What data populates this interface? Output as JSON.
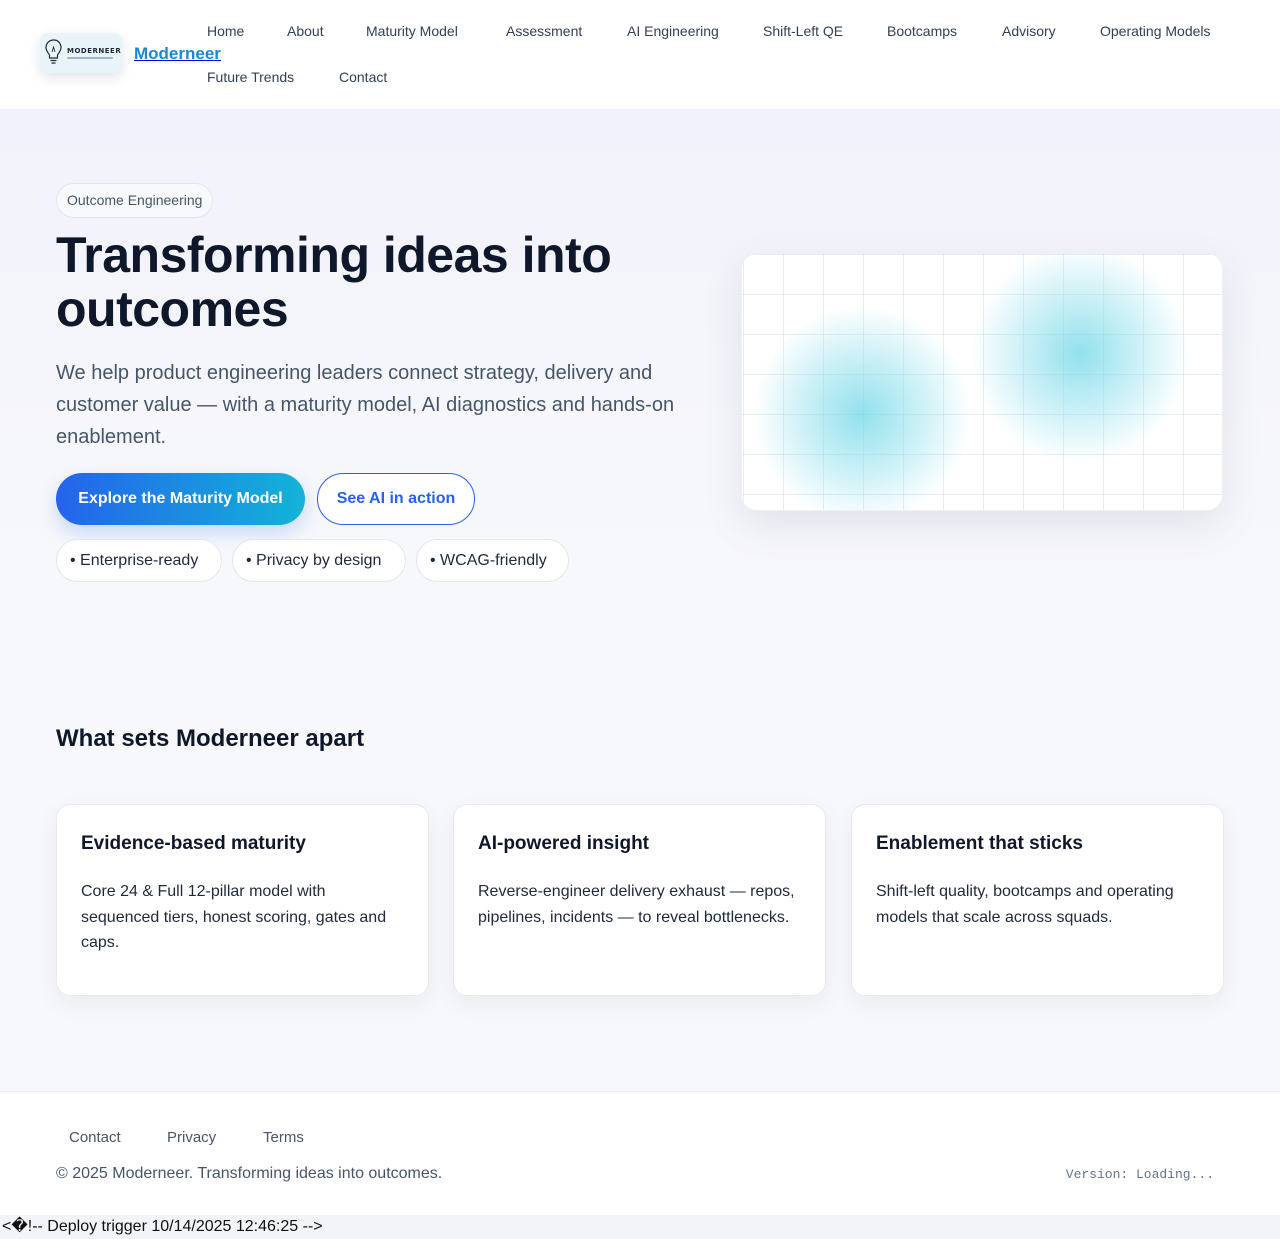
{
  "brand": {
    "logo_text": "MODERNEER",
    "name": "Moderneer"
  },
  "nav": [
    {
      "label": "Home"
    },
    {
      "label": "About"
    },
    {
      "label": "Maturity Model"
    },
    {
      "label": "Assessment"
    },
    {
      "label": "AI Engineering"
    },
    {
      "label": "Shift-Left QE"
    },
    {
      "label": "Bootcamps"
    },
    {
      "label": "Advisory"
    },
    {
      "label": "Operating Models"
    },
    {
      "label": "Future Trends"
    },
    {
      "label": "Contact"
    }
  ],
  "hero": {
    "eyebrow": "Outcome Engineering",
    "title": "Transforming ideas into outcomes",
    "subtitle": "We help product engineering leaders connect strategy, delivery and customer value — with a maturity model, AI diagnostics and hands-on enablement.",
    "primary_cta": "Explore the Maturity Model",
    "secondary_cta": "See AI in action",
    "chips": [
      "• Enterprise-ready",
      "• Privacy by design",
      "• WCAG-friendly"
    ]
  },
  "features": {
    "title": "What sets Moderneer apart",
    "cards": [
      {
        "title": "Evidence-based maturity",
        "text": "Core 24 & Full 12-pillar model with sequenced tiers, honest scoring, gates and caps."
      },
      {
        "title": "AI-powered insight",
        "text": "Reverse-engineer delivery exhaust — repos, pipelines, incidents — to reveal bottlenecks."
      },
      {
        "title": "Enablement that sticks",
        "text": "Shift-left quality, bootcamps and operating models that scale across squads."
      }
    ]
  },
  "footer": {
    "links": [
      {
        "label": "Contact"
      },
      {
        "label": "Privacy"
      },
      {
        "label": "Terms"
      }
    ],
    "copyright": "© 2025 Moderneer. Transforming ideas into outcomes.",
    "version": "Version: Loading..."
  },
  "deploy_note": "<�!-- Deploy trigger 10/14/2025 12:46:25 -->",
  "colors": {
    "brand": "#1a8ad0",
    "accent": "#2563eb",
    "accent_gradient_end": "#13b3d8",
    "text": "#0f172a",
    "muted": "#475569"
  }
}
